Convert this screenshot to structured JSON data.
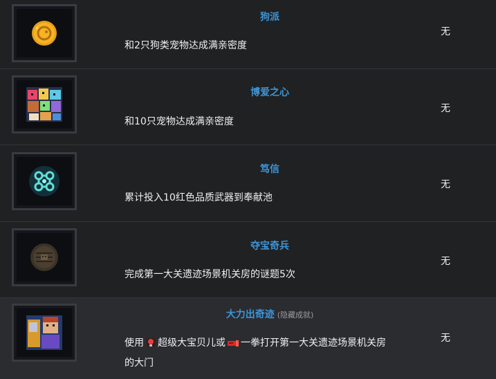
{
  "achievements": [
    {
      "title": "狗派",
      "desc": "和2只狗类宠物达成满亲密度",
      "reward": "无",
      "icon": "gold-dog-coin-icon"
    },
    {
      "title": "博爱之心",
      "desc": "和10只宠物达成满亲密度",
      "reward": "无",
      "icon": "pets-collage-icon"
    },
    {
      "title": "笃信",
      "desc": "累计投入10红色品质武器到奉献池",
      "reward": "无",
      "icon": "teal-swirl-rune-icon"
    },
    {
      "title": "夺宝奇兵",
      "desc": "完成第一大关遗迹场景机关房的谜题5次",
      "reward": "无",
      "icon": "stone-tablet-icon"
    },
    {
      "title": "大力出奇迹",
      "tag": "(隐藏成就)",
      "desc_part1": "使用",
      "desc_part2": "超级大宝贝儿或",
      "desc_part3": "一拳打开第一大关遗迹场景机关房",
      "desc_line2": "的大门",
      "reward": "无",
      "icon": "warrior-portrait-icon"
    }
  ]
}
